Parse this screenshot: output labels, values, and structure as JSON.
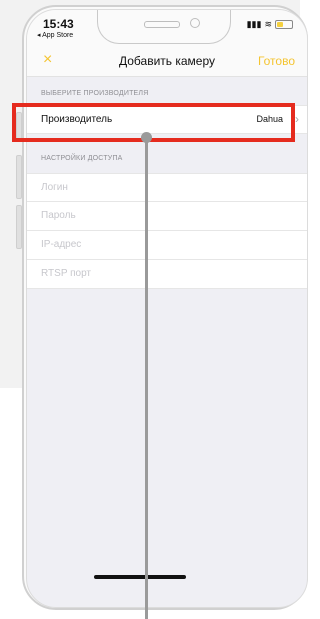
{
  "status_bar": {
    "time": "15:43",
    "back_label": "◂ App Store",
    "signal": "▮▮▮",
    "wifi": "≋"
  },
  "nav": {
    "close_icon": "×",
    "title": "Добавить камеру",
    "done_label": "Готово"
  },
  "manufacturer_section": {
    "header": "ВЫБЕРИТЕ ПРОИЗВОДИТЕЛЯ",
    "label": "Производитель",
    "value": "Dahua",
    "chevron": "›"
  },
  "access_section": {
    "header": "НАСТРОЙКИ ДОСТУПА",
    "login_placeholder": "Логин",
    "password_placeholder": "Пароль",
    "ip_placeholder": "IP-адрес",
    "rtsp_placeholder": "RTSP порт"
  },
  "colors": {
    "accent": "#f4c430",
    "highlight": "#e52b1e"
  }
}
